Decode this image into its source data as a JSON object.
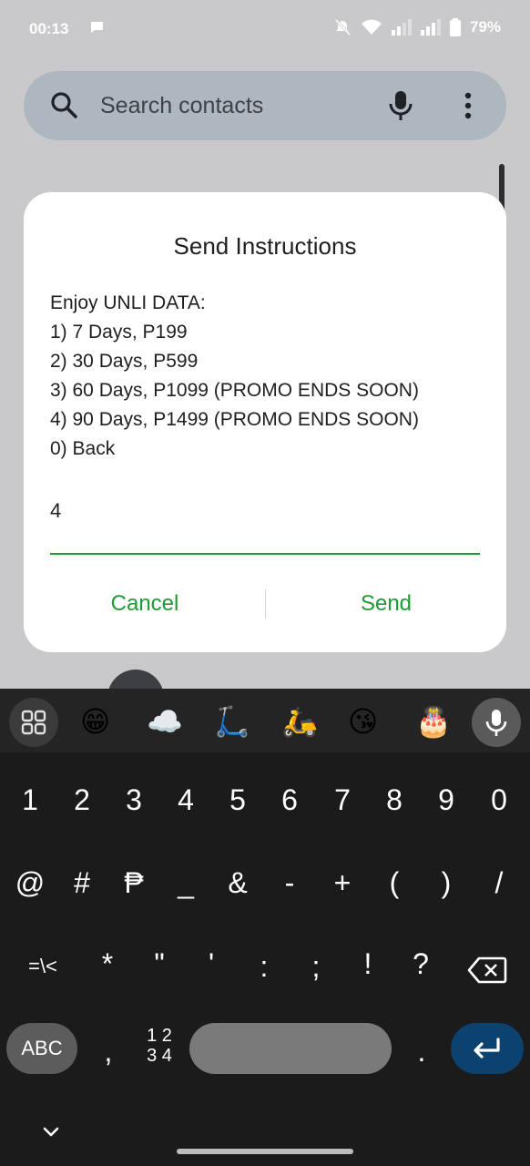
{
  "status_bar": {
    "time": "00:13",
    "battery": "79%"
  },
  "search": {
    "placeholder": "Search contacts"
  },
  "dialog": {
    "title": "Send Instructions",
    "lines": [
      "Enjoy UNLI DATA:",
      "1) 7 Days, P199",
      "2) 30 Days, P599",
      "3) 60 Days, P1099 (PROMO ENDS SOON)",
      "4) 90 Days, P1499 (PROMO ENDS SOON)",
      "0) Back"
    ],
    "input_value": "4",
    "cancel_label": "Cancel",
    "send_label": "Send"
  },
  "keyboard": {
    "toolbar_emojis": [
      "😁",
      "☁️",
      "🛴",
      "🛵",
      "😘",
      "🎂"
    ],
    "row1": [
      "1",
      "2",
      "3",
      "4",
      "5",
      "6",
      "7",
      "8",
      "9",
      "0"
    ],
    "row2": [
      "@",
      "#",
      "₱",
      "_",
      "&",
      "-",
      "+",
      "(",
      ")",
      "/"
    ],
    "row3": [
      "=\\<",
      "*",
      "\"",
      "'",
      ":",
      ";",
      "!",
      "?"
    ],
    "abc_label": "ABC",
    "comma": ",",
    "numpad_label_top": "1 2",
    "numpad_label_bottom": "3 4",
    "period": "."
  },
  "colors": {
    "accent": "#1f9a35",
    "enter_key": "#0c4270"
  },
  "icons": [
    "search-icon",
    "mic-icon",
    "more-vert-icon",
    "apps-grid-icon",
    "backspace-icon",
    "enter-icon",
    "chevron-down-icon",
    "wifi-icon",
    "mute-icon",
    "signal-icon",
    "battery-icon",
    "chat-icon"
  ]
}
